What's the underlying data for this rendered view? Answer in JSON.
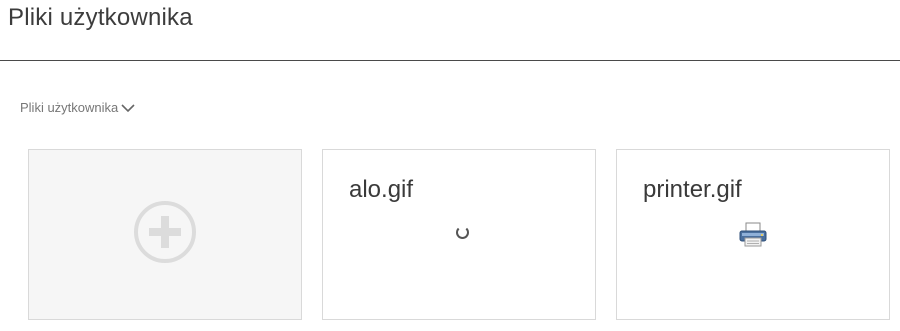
{
  "page": {
    "title": "Pliki użytkownika"
  },
  "breadcrumb": {
    "label": "Pliki użytkownika",
    "icon": "chevron-down-icon"
  },
  "tiles": [
    {
      "type": "add",
      "icon": "add-circle-icon"
    },
    {
      "type": "file",
      "name": "alo.gif",
      "thumbnail": "spinner-icon"
    },
    {
      "type": "file",
      "name": "printer.gif",
      "thumbnail": "printer-icon"
    }
  ],
  "colors": {
    "text": "#3a3a3a",
    "muted": "#777777",
    "border": "#d9d9d9",
    "add_tile_bg": "#f6f6f6",
    "add_icon": "#dcdcdc"
  }
}
